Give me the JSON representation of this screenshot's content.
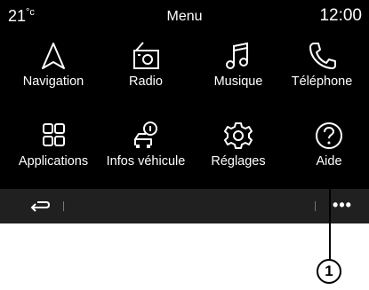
{
  "status": {
    "temperature": "21",
    "temperature_unit": "°c",
    "title": "Menu",
    "clock": "12:00"
  },
  "tiles": [
    {
      "label": "Navigation",
      "icon": "navigation-arrow-icon"
    },
    {
      "label": "Radio",
      "icon": "radio-icon"
    },
    {
      "label": "Musique",
      "icon": "music-note-icon"
    },
    {
      "label": "Téléphone",
      "icon": "phone-icon"
    },
    {
      "label": "Applications",
      "icon": "apps-grid-icon"
    },
    {
      "label": "Infos véhicule",
      "icon": "vehicle-info-icon"
    },
    {
      "label": "Réglages",
      "icon": "gear-icon"
    },
    {
      "label": "Aide",
      "icon": "help-icon"
    }
  ],
  "bottom_bar": {
    "back_icon": "back-arrow-icon",
    "more_label": "•••"
  },
  "callout": {
    "label": "1"
  }
}
